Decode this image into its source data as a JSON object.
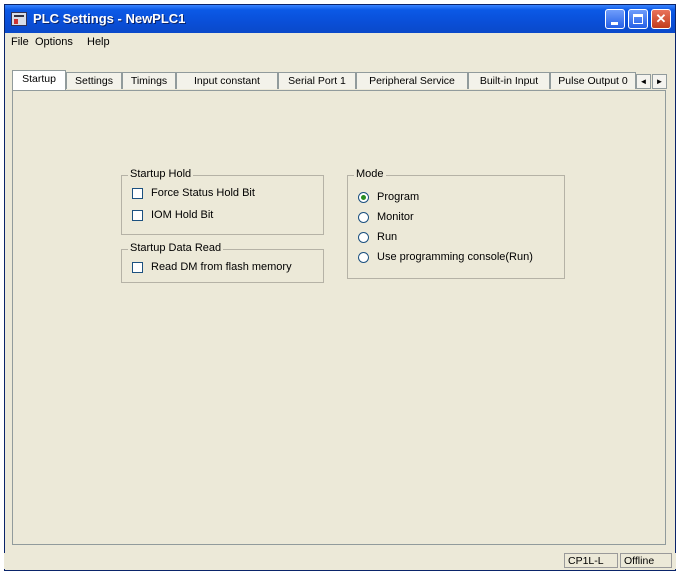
{
  "window": {
    "title": "PLC Settings - NewPLC1"
  },
  "menu": {
    "items": [
      "File",
      "Options",
      "Help"
    ]
  },
  "tabs": [
    {
      "label": "Startup",
      "active": true
    },
    {
      "label": "Settings",
      "active": false
    },
    {
      "label": "Timings",
      "active": false
    },
    {
      "label": "Input constant",
      "active": false
    },
    {
      "label": "Serial Port 1",
      "active": false
    },
    {
      "label": "Peripheral Service",
      "active": false
    },
    {
      "label": "Built-in Input",
      "active": false
    },
    {
      "label": "Pulse Output 0",
      "active": false
    }
  ],
  "tab_scroll": {
    "left": "◄",
    "right": "►"
  },
  "startup_hold": {
    "title": "Startup Hold",
    "options": [
      {
        "label": "Force Status Hold Bit",
        "checked": false
      },
      {
        "label": "IOM Hold Bit",
        "checked": false
      }
    ]
  },
  "startup_data_read": {
    "title": "Startup Data Read",
    "options": [
      {
        "label": "Read DM from flash memory",
        "checked": false
      }
    ]
  },
  "mode": {
    "title": "Mode",
    "options": [
      {
        "label": "Program",
        "selected": true
      },
      {
        "label": "Monitor",
        "selected": false
      },
      {
        "label": "Run",
        "selected": false
      },
      {
        "label": "Use programming console(Run)",
        "selected": false
      }
    ]
  },
  "status": {
    "model": "CP1L-L",
    "connection": "Offline"
  },
  "colors": {
    "titlebar": "#0a4fd8",
    "dialog_bg": "#ece9d8",
    "close_button": "#c13b1b"
  }
}
